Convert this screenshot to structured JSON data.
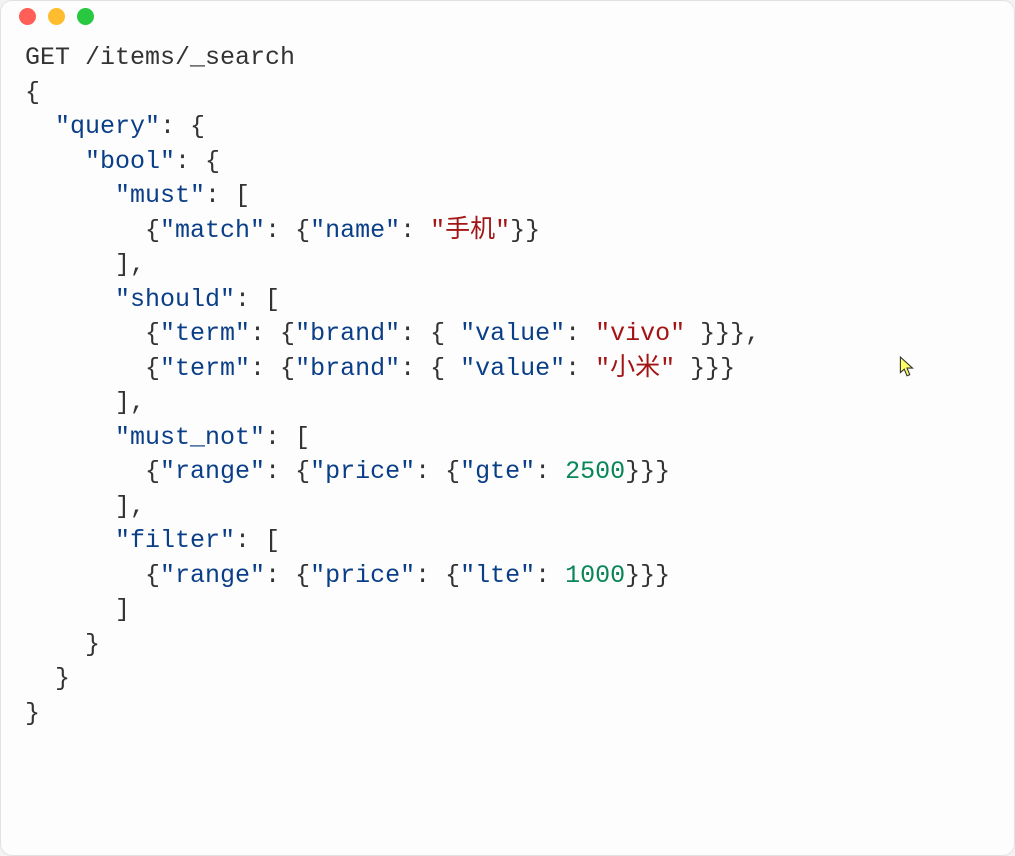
{
  "request_line": "GET /items/_search",
  "query": {
    "keys": {
      "query": "\"query\"",
      "bool": "\"bool\"",
      "must": "\"must\"",
      "should": "\"should\"",
      "must_not": "\"must_not\"",
      "filter": "\"filter\"",
      "match": "\"match\"",
      "term": "\"term\"",
      "range": "\"range\"",
      "name": "\"name\"",
      "brand": "\"brand\"",
      "value": "\"value\"",
      "price": "\"price\"",
      "gte": "\"gte\"",
      "lte": "\"lte\""
    },
    "values": {
      "match_name": "\"手机\"",
      "brand_vivo": "\"vivo\"",
      "brand_xiaomi": "\"小米\"",
      "gte_price": "2500",
      "lte_price": "1000"
    }
  },
  "colors": {
    "key": "#0a3e87",
    "string": "#a31515",
    "number": "#098658",
    "punct": "#333333"
  }
}
